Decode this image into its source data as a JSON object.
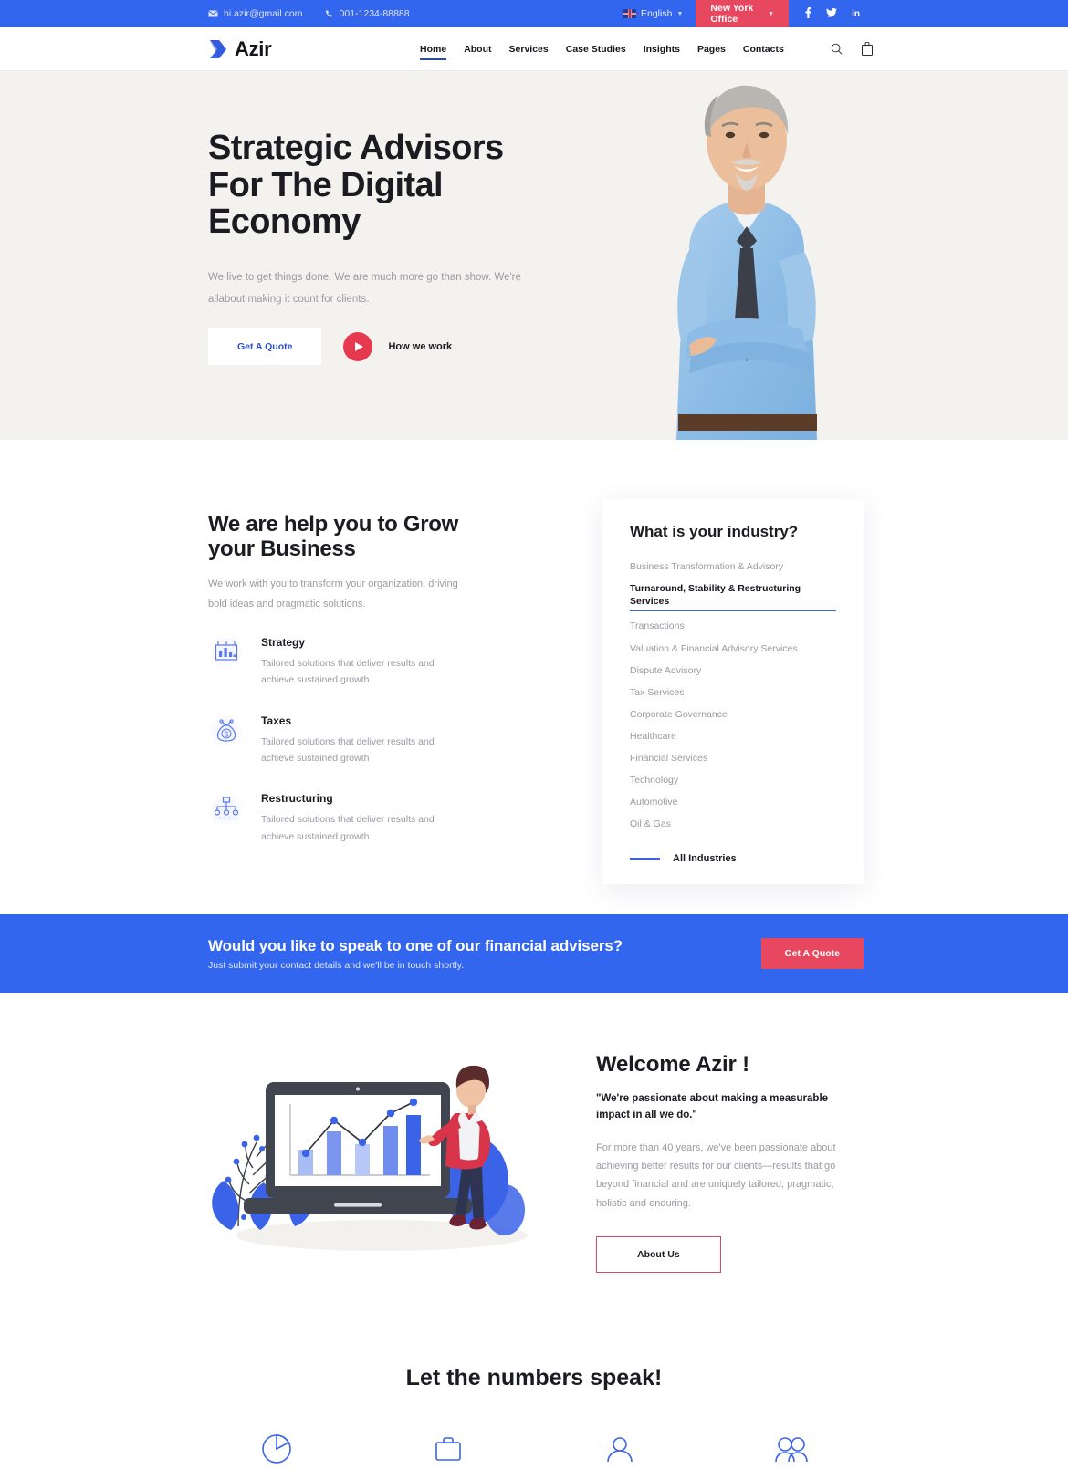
{
  "topbar": {
    "email": "hi.azir@gmail.com",
    "phone": "001-1234-88888",
    "language": "English",
    "office": "New York Office",
    "socials": [
      "f",
      "t",
      "in"
    ],
    "accent_blue": "#3366ee",
    "accent_red": "#e8485f"
  },
  "header": {
    "brand": "Azir",
    "nav": [
      {
        "label": "Home",
        "active": true
      },
      {
        "label": "About",
        "active": false
      },
      {
        "label": "Services",
        "active": false
      },
      {
        "label": "Case Studies",
        "active": false
      },
      {
        "label": "Insights",
        "active": false
      },
      {
        "label": "Pages",
        "active": false
      },
      {
        "label": "Contacts",
        "active": false
      }
    ],
    "icons": [
      "search-icon",
      "bag-icon"
    ]
  },
  "hero": {
    "title": "Strategic Advisors For The Digital Economy",
    "paragraph": "We live to get things done. We are much more go than show. We're allabout making it count for clients.",
    "primary_button": "Get A Quote",
    "video_label": "How we work",
    "background": "#f4f2ef"
  },
  "grow": {
    "heading": "We are help you to Grow your Business",
    "subheading": "We work with you to transform your organization, driving bold ideas and pragmatic solutions.",
    "features": [
      {
        "icon": "bar-chart-icon",
        "title": "Strategy",
        "desc": "Tailored solutions that deliver results and achieve sustained growth"
      },
      {
        "icon": "money-bag-icon",
        "title": "Taxes",
        "desc": "Tailored solutions that deliver results and achieve sustained growth"
      },
      {
        "icon": "org-chart-icon",
        "title": "Restructuring",
        "desc": "Tailored solutions that deliver results and achieve sustained growth"
      }
    ]
  },
  "industry": {
    "heading": "What is your industry?",
    "items": [
      {
        "label": "Business Transformation & Advisory",
        "active": false
      },
      {
        "label": "Turnaround, Stability & Restructuring Services",
        "active": true
      },
      {
        "label": "Transactions",
        "active": false
      },
      {
        "label": "Valuation & Financial Advisory Services",
        "active": false
      },
      {
        "label": "Dispute Advisory",
        "active": false
      },
      {
        "label": "Tax Services",
        "active": false
      },
      {
        "label": "Corporate Governance",
        "active": false
      },
      {
        "label": "Healthcare",
        "active": false
      },
      {
        "label": "Financial Services",
        "active": false
      },
      {
        "label": "Technology",
        "active": false
      },
      {
        "label": "Automotive",
        "active": false
      },
      {
        "label": "Oil & Gas",
        "active": false
      }
    ],
    "all_link": "All Industries"
  },
  "cta": {
    "title": "Would you like to speak to one of our financial advisers?",
    "subtitle": "Just submit your contact details and we'll be in touch shortly.",
    "button": "Get A Quote"
  },
  "welcome": {
    "heading": "Welcome Azir !",
    "quote": "\"We're passionate about making a measurable impact in all we do.\"",
    "paragraph": "For more than 40 years, we've been passionate about achieving better results for our clients—results that go beyond financial and are uniquely tailored, pragmatic, holistic and enduring.",
    "button": "About Us",
    "illustration": {
      "type": "bar",
      "bars": [
        30,
        58,
        40,
        72,
        92
      ],
      "line": [
        22,
        60,
        35,
        75,
        96
      ]
    }
  },
  "numbers": {
    "heading": "Let the numbers speak!",
    "icons": [
      "pie-chart-icon",
      "briefcase-icon",
      "person-icon",
      "handshake-icon"
    ]
  }
}
